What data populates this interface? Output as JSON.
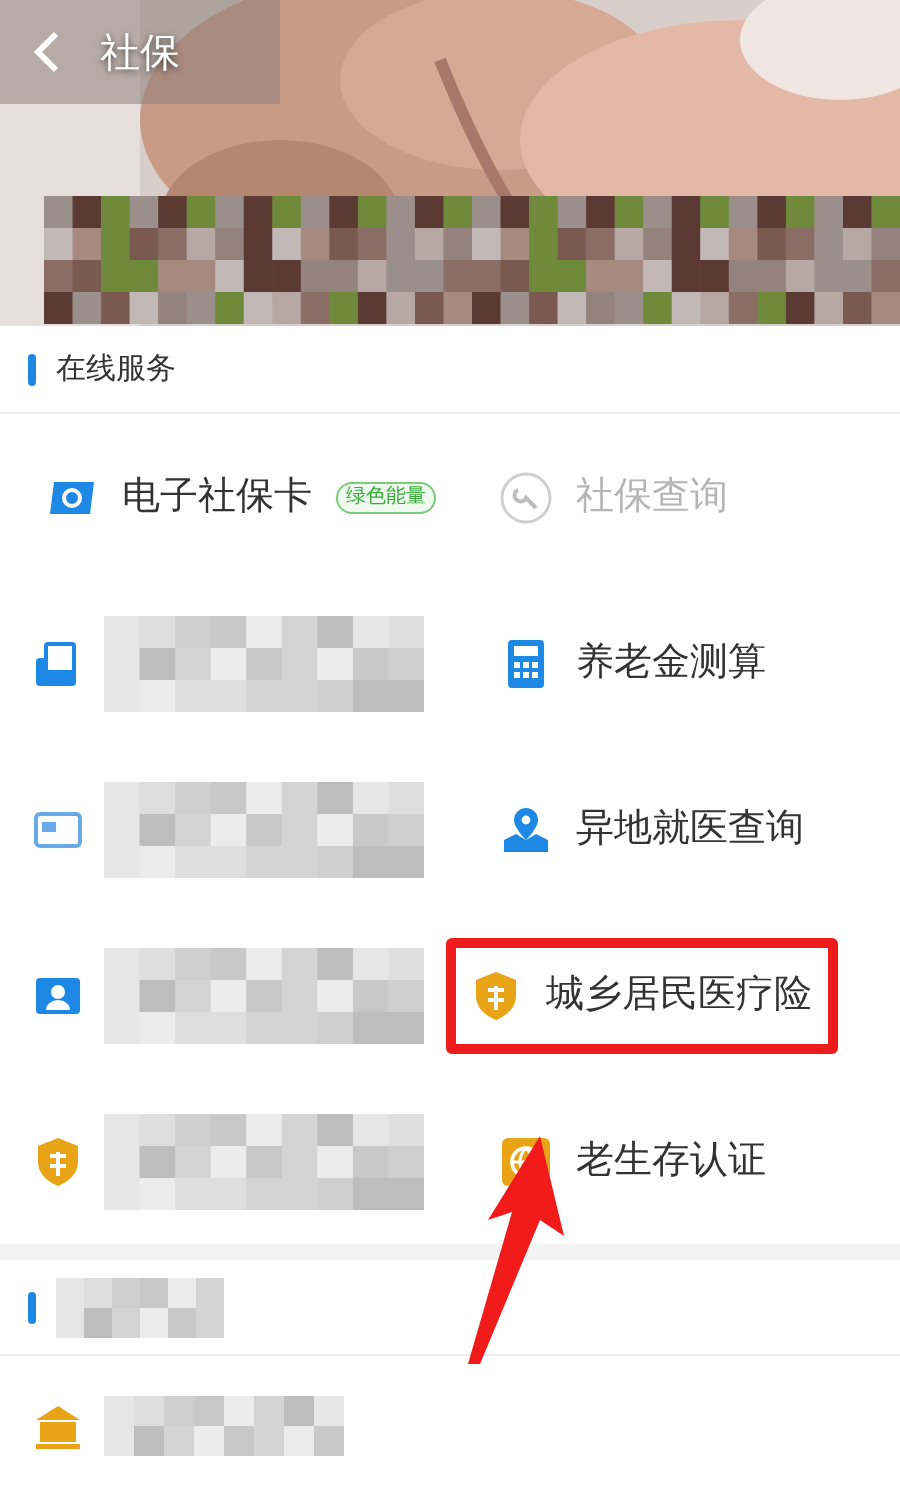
{
  "header": {
    "title": "社保"
  },
  "section": {
    "title": "在线服务"
  },
  "services": [
    {
      "kind": "link",
      "label": "电子社保卡",
      "badge": "绿色能量",
      "disabled": false,
      "highlighted": false
    },
    {
      "kind": "link",
      "label": "社保查询",
      "disabled": true,
      "highlighted": false
    },
    {
      "kind": "redacted"
    },
    {
      "kind": "link",
      "label": "养老金测算",
      "disabled": false,
      "highlighted": false
    },
    {
      "kind": "redacted"
    },
    {
      "kind": "link",
      "label": "异地就医查询",
      "disabled": false,
      "highlighted": false
    },
    {
      "kind": "redacted"
    },
    {
      "kind": "link",
      "label": "城乡居民医疗险",
      "disabled": false,
      "highlighted": true
    },
    {
      "kind": "redacted"
    },
    {
      "kind": "link",
      "label": "老生存认证",
      "disabled": false,
      "highlighted": false
    }
  ],
  "section2": {
    "kind": "redacted"
  },
  "services2": [
    {
      "kind": "redacted"
    }
  ]
}
